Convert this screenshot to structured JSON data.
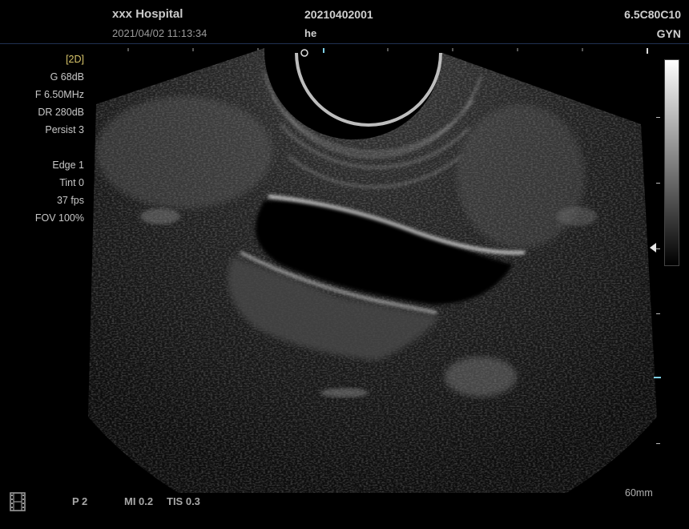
{
  "header": {
    "hospital": "xxx Hospital",
    "datetime": "2021/04/02 11:13:34",
    "patient_id": "20210402001",
    "operator": "he",
    "probe": "6.5C80C10",
    "exam": "GYN"
  },
  "params": {
    "mode": "[2D]",
    "gain": "G 68dB",
    "frequency": "F 6.50MHz",
    "dynamic_range": "DR 280dB",
    "persist": "Persist 3",
    "edge": "Edge 1",
    "tint": "Tint 0",
    "frame_rate": "37 fps",
    "fov": "FOV 100%"
  },
  "footer": {
    "cine_icon": "film-strip-icon",
    "power": "P 2",
    "mi": "MI 0.2",
    "tis": "TIS 0.3",
    "depth": "60mm"
  },
  "colors": {
    "mode_label": "#d8c56a",
    "focus_marker": "#7fd0e6",
    "header_rule": "#203050"
  }
}
